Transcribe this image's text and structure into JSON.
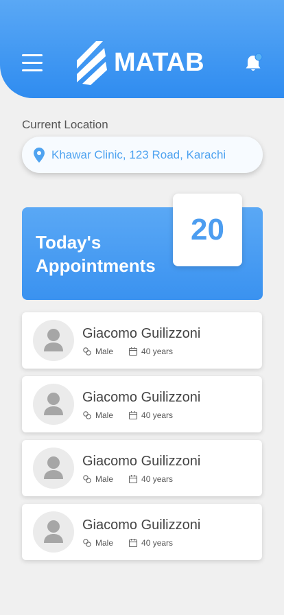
{
  "header": {
    "brand": "MATAB",
    "accent_color": "#2f8cf0",
    "menu_icon": "hamburger-icon",
    "notification_icon": "bell-icon",
    "notification_dot_color": "#5ab4f5"
  },
  "location": {
    "label": "Current Location",
    "value": "Khawar Clinic, 123 Road, Karachi",
    "icon": "map-pin-icon"
  },
  "appointments": {
    "title_line1": "Today's",
    "title_line2": "Appointments",
    "count": "20"
  },
  "patients": [
    {
      "name": "Giacomo Guilizzoni",
      "gender": "Male",
      "age": "40 years"
    },
    {
      "name": "Giacomo Guilizzoni",
      "gender": "Male",
      "age": "40 years"
    },
    {
      "name": "Giacomo Guilizzoni",
      "gender": "Male",
      "age": "40 years"
    },
    {
      "name": "Giacomo Guilizzoni",
      "gender": "Male",
      "age": "40 years"
    }
  ]
}
